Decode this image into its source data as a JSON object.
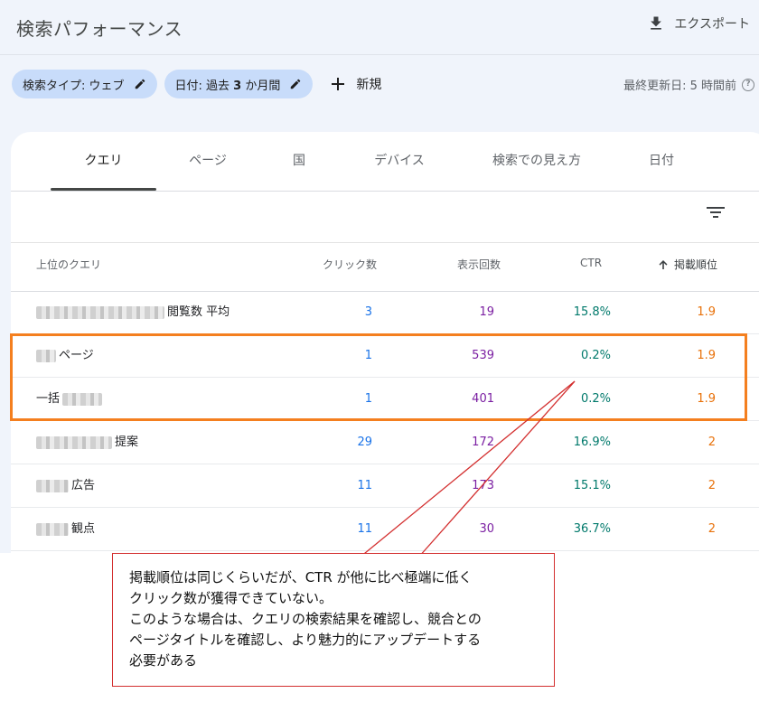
{
  "header": {
    "title": "検索パフォーマンス",
    "export_label": "エクスポート",
    "last_updated": "最終更新日: 5 時間前"
  },
  "filters": {
    "search_type": "検索タイプ: ウェブ",
    "date_prefix": "日付: 過去",
    "date_value": "3",
    "date_suffix": "か月間",
    "new_label": "新規"
  },
  "tabs": [
    {
      "label": "クエリ",
      "active": true
    },
    {
      "label": "ページ"
    },
    {
      "label": "国"
    },
    {
      "label": "デバイス"
    },
    {
      "label": "検索での見え方"
    },
    {
      "label": "日付"
    }
  ],
  "table": {
    "columns": {
      "query": "上位のクエリ",
      "clicks": "クリック数",
      "impressions": "表示回数",
      "ctr": "CTR",
      "position": "掲載順位"
    },
    "rows": [
      {
        "query": "閲覧数 平均",
        "clicks": "3",
        "impressions": "19",
        "ctr": "15.8%",
        "position": "1.9"
      },
      {
        "query": "ページ",
        "clicks": "1",
        "impressions": "539",
        "ctr": "0.2%",
        "position": "1.9"
      },
      {
        "query": "一括",
        "clicks": "1",
        "impressions": "401",
        "ctr": "0.2%",
        "position": "1.9"
      },
      {
        "query": "提案",
        "clicks": "29",
        "impressions": "172",
        "ctr": "16.9%",
        "position": "2"
      },
      {
        "query": "広告",
        "clicks": "11",
        "impressions": "173",
        "ctr": "15.1%",
        "position": "2"
      },
      {
        "query": "観点",
        "clicks": "11",
        "impressions": "30",
        "ctr": "36.7%",
        "position": "2"
      }
    ]
  },
  "annotation": {
    "lines": [
      "掲載順位は同じくらいだが、CTR が他に比べ極端に低く",
      "クリック数が獲得できていない。",
      "このような場合は、クエリの検索結果を確認し、競合との",
      "ページタイトルを確認し、より魅力的にアップデートする",
      "必要がある"
    ]
  },
  "colors": {
    "clicks": "#1a73e8",
    "impressions": "#7b1fa2",
    "ctr": "#00796b",
    "position": "#e8710a",
    "highlight_box": "#f47f1f",
    "callout_border": "#d32f2f"
  }
}
